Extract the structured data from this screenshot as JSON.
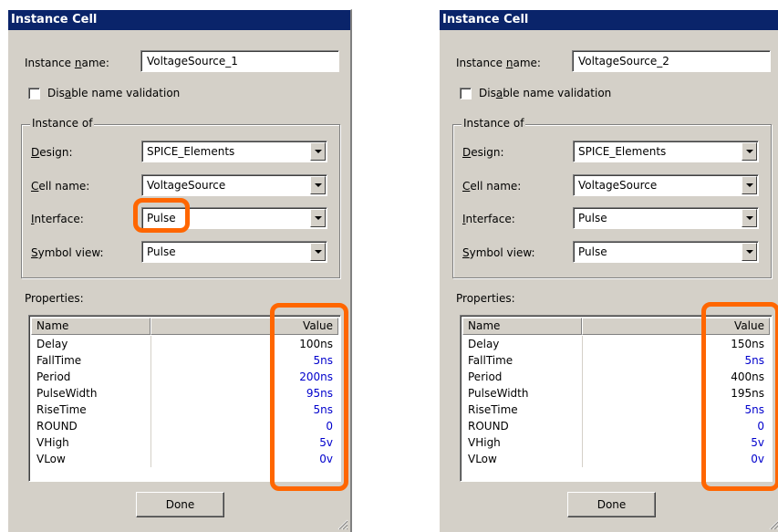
{
  "dialogs": [
    {
      "title": "Instance Cell",
      "instance_name_label_pre": "Instance ",
      "instance_name_label_u": "n",
      "instance_name_label_post": "ame:",
      "instance_name_value": "VoltageSource_1",
      "disable_label_pre": "Dis",
      "disable_label_u": "a",
      "disable_label_post": "ble name validation",
      "instance_of_label": "Instance of",
      "design_label_u": "D",
      "design_label_post": "esign:",
      "design_value": "SPICE_Elements",
      "cell_label_u": "C",
      "cell_label_post": "ell name:",
      "cell_value": "VoltageSource",
      "interface_label_u": "I",
      "interface_label_post": "nterface:",
      "interface_value": "Pulse",
      "symbol_label_u": "S",
      "symbol_label_post": "ymbol view:",
      "symbol_value": "Pulse",
      "properties_label": "Properties:",
      "col_name": "Name",
      "col_value": "Value",
      "rows": [
        {
          "name": "Delay",
          "value": "100ns"
        },
        {
          "name": "FallTime",
          "value": "5ns"
        },
        {
          "name": "Period",
          "value": "200ns"
        },
        {
          "name": "PulseWidth",
          "value": "95ns"
        },
        {
          "name": "RiseTime",
          "value": "5ns"
        },
        {
          "name": "ROUND",
          "value": "0"
        },
        {
          "name": "VHigh",
          "value": "5v"
        },
        {
          "name": "VLow",
          "value": "0v"
        }
      ],
      "done_label": "Done"
    },
    {
      "title": "Instance Cell",
      "instance_name_label_pre": "Instance ",
      "instance_name_label_u": "n",
      "instance_name_label_post": "ame:",
      "instance_name_value": "VoltageSource_2",
      "disable_label_pre": "Dis",
      "disable_label_u": "a",
      "disable_label_post": "ble name validation",
      "instance_of_label": "Instance of",
      "design_label_u": "D",
      "design_label_post": "esign:",
      "design_value": "SPICE_Elements",
      "cell_label_u": "C",
      "cell_label_post": "ell name:",
      "cell_value": "VoltageSource",
      "interface_label_u": "I",
      "interface_label_post": "nterface:",
      "interface_value": "Pulse",
      "symbol_label_u": "S",
      "symbol_label_post": "ymbol view:",
      "symbol_value": "Pulse",
      "properties_label": "Properties:",
      "col_name": "Name",
      "col_value": "Value",
      "rows": [
        {
          "name": "Delay",
          "value": "150ns"
        },
        {
          "name": "FallTime",
          "value": "5ns"
        },
        {
          "name": "Period",
          "value": "400ns"
        },
        {
          "name": "PulseWidth",
          "value": "195ns"
        },
        {
          "name": "RiseTime",
          "value": "5ns"
        },
        {
          "name": "ROUND",
          "value": "0"
        },
        {
          "name": "VHigh",
          "value": "5v"
        },
        {
          "name": "VLow",
          "value": "0v"
        }
      ],
      "done_label": "Done"
    }
  ],
  "value_colors": {
    "dialog1": [
      "#000000",
      "#0000cc",
      "#0000cc",
      "#0000cc",
      "#0000cc",
      "#0000cc",
      "#0000cc",
      "#0000cc"
    ],
    "dialog2": [
      "#000000",
      "#0000cc",
      "#000000",
      "#000000",
      "#0000cc",
      "#0000cc",
      "#0000cc",
      "#0000cc"
    ]
  },
  "highlight_color": "#ff6600",
  "icons": {
    "combo_arrow": "chevron-down-icon",
    "resize": "resize-grip-icon",
    "checkbox": "checkbox-unchecked-icon"
  }
}
